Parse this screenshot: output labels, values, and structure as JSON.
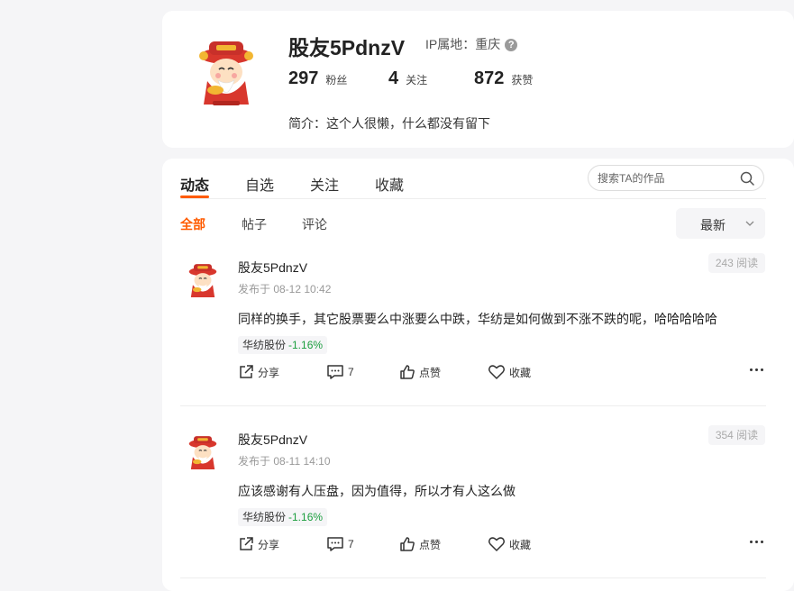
{
  "profile": {
    "username": "股友5PdnzV",
    "ip_label": "IP属地：重庆",
    "stats": [
      {
        "value": "297",
        "label": "粉丝"
      },
      {
        "value": "4",
        "label": "关注"
      },
      {
        "value": "872",
        "label": "获赞"
      }
    ],
    "bio": "简介：这个人很懒，什么都没有留下"
  },
  "tabs": [
    "动态",
    "自选",
    "关注",
    "收藏"
  ],
  "search": {
    "placeholder": "搜索TA的作品"
  },
  "filters": [
    "全部",
    "帖子",
    "评论"
  ],
  "sort": {
    "selected": "最新"
  },
  "posts": [
    {
      "author": "股友5PdnzV",
      "time": "发布于 08-12 10:42",
      "reads": "243 阅读",
      "text": "同样的换手，其它股票要么中涨要么中跌，华纺是如何做到不涨不跌的呢，哈哈哈哈哈",
      "tag": {
        "name": "华纺股份",
        "change": "-1.16%"
      },
      "actions": {
        "share": "分享",
        "comments": "7",
        "like": "点赞",
        "favorite": "收藏"
      }
    },
    {
      "author": "股友5PdnzV",
      "time": "发布于 08-11 14:10",
      "reads": "354 阅读",
      "text": "应该感谢有人压盘，因为值得，所以才有人这么做",
      "tag": {
        "name": "华纺股份",
        "change": "-1.16%"
      },
      "actions": {
        "share": "分享",
        "comments": "7",
        "like": "点赞",
        "favorite": "收藏"
      }
    }
  ],
  "colors": {
    "accent": "#ff5b00",
    "negative_change": "#1b9e3e",
    "page_bg": "#f5f5f7"
  }
}
